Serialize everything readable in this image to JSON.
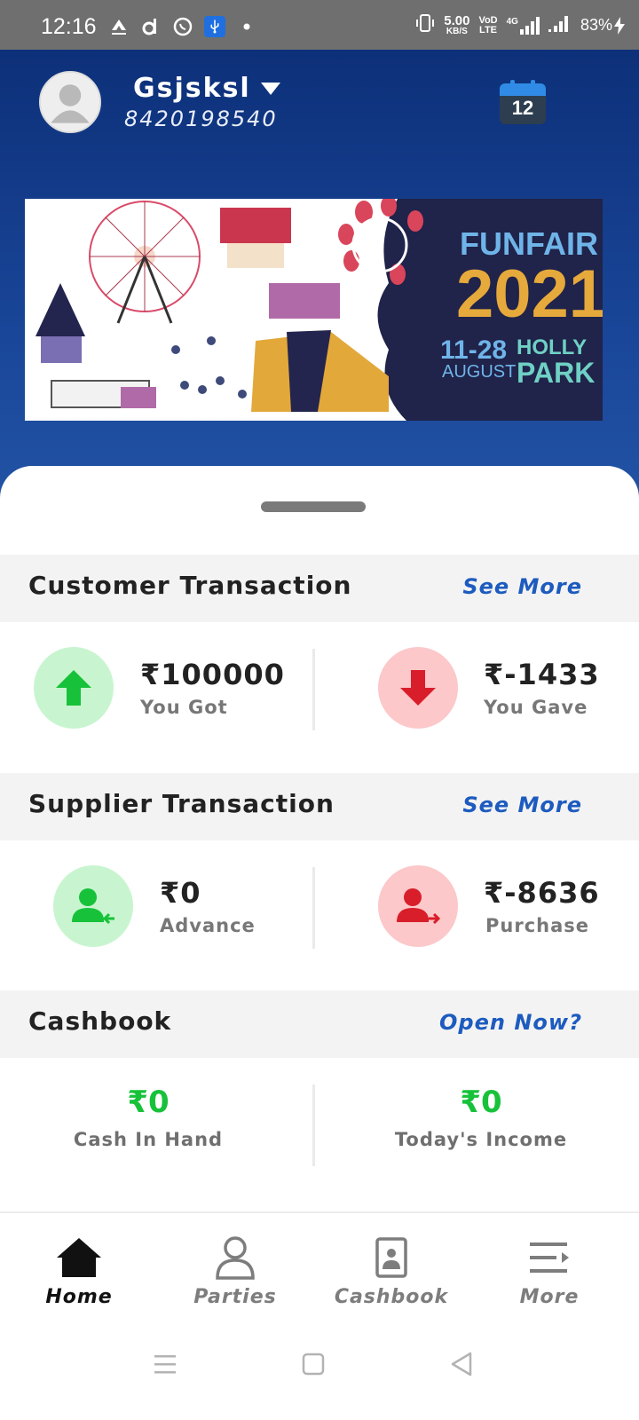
{
  "status_bar": {
    "time": "12:16",
    "icons_left": [
      "navigation-app-icon",
      "d-app-icon",
      "whatsapp-icon",
      "usb-icon",
      "dot-icon"
    ],
    "speed_value": "5.00",
    "speed_unit": "KB/S",
    "volte_top": "VoD",
    "volte_bottom": "LTE",
    "network": "4G",
    "battery": "83%"
  },
  "header": {
    "user_name": "Gsjsksl",
    "phone": "8420198540",
    "calendar_day": "12"
  },
  "banner": {
    "line1": "FUNFAIR",
    "line2": "2021",
    "dates": "11-28",
    "month": "AUGUST",
    "place1": "HOLLY",
    "place2": "PARK",
    "colors": {
      "panel": "#20234a",
      "title": "#6fb4e8",
      "year": "#e6a93b",
      "place": "#6fd0c4"
    }
  },
  "customer": {
    "title": "Customer Transaction",
    "link": "See More",
    "got_amount": "₹100000",
    "got_label": "You Got",
    "gave_amount": "₹-1433",
    "gave_label": "You Gave"
  },
  "supplier": {
    "title": "Supplier Transaction",
    "link": "See More",
    "advance_amount": "₹0",
    "advance_label": "Advance",
    "purchase_amount": "₹-8636",
    "purchase_label": "Purchase"
  },
  "cashbook": {
    "title": "Cashbook",
    "link": "Open Now?",
    "cash_in_hand_amount": "₹0",
    "cash_in_hand_label": "Cash In Hand",
    "income_amount": "₹0",
    "income_label": "Today's Income"
  },
  "bottom_nav": {
    "home": "Home",
    "parties": "Parties",
    "cashbook": "Cashbook",
    "more": "More"
  },
  "colors": {
    "header_bg": "#0d3079",
    "link": "#1d5bbf",
    "positive": "#17c23a",
    "negative": "#d81e2a"
  }
}
